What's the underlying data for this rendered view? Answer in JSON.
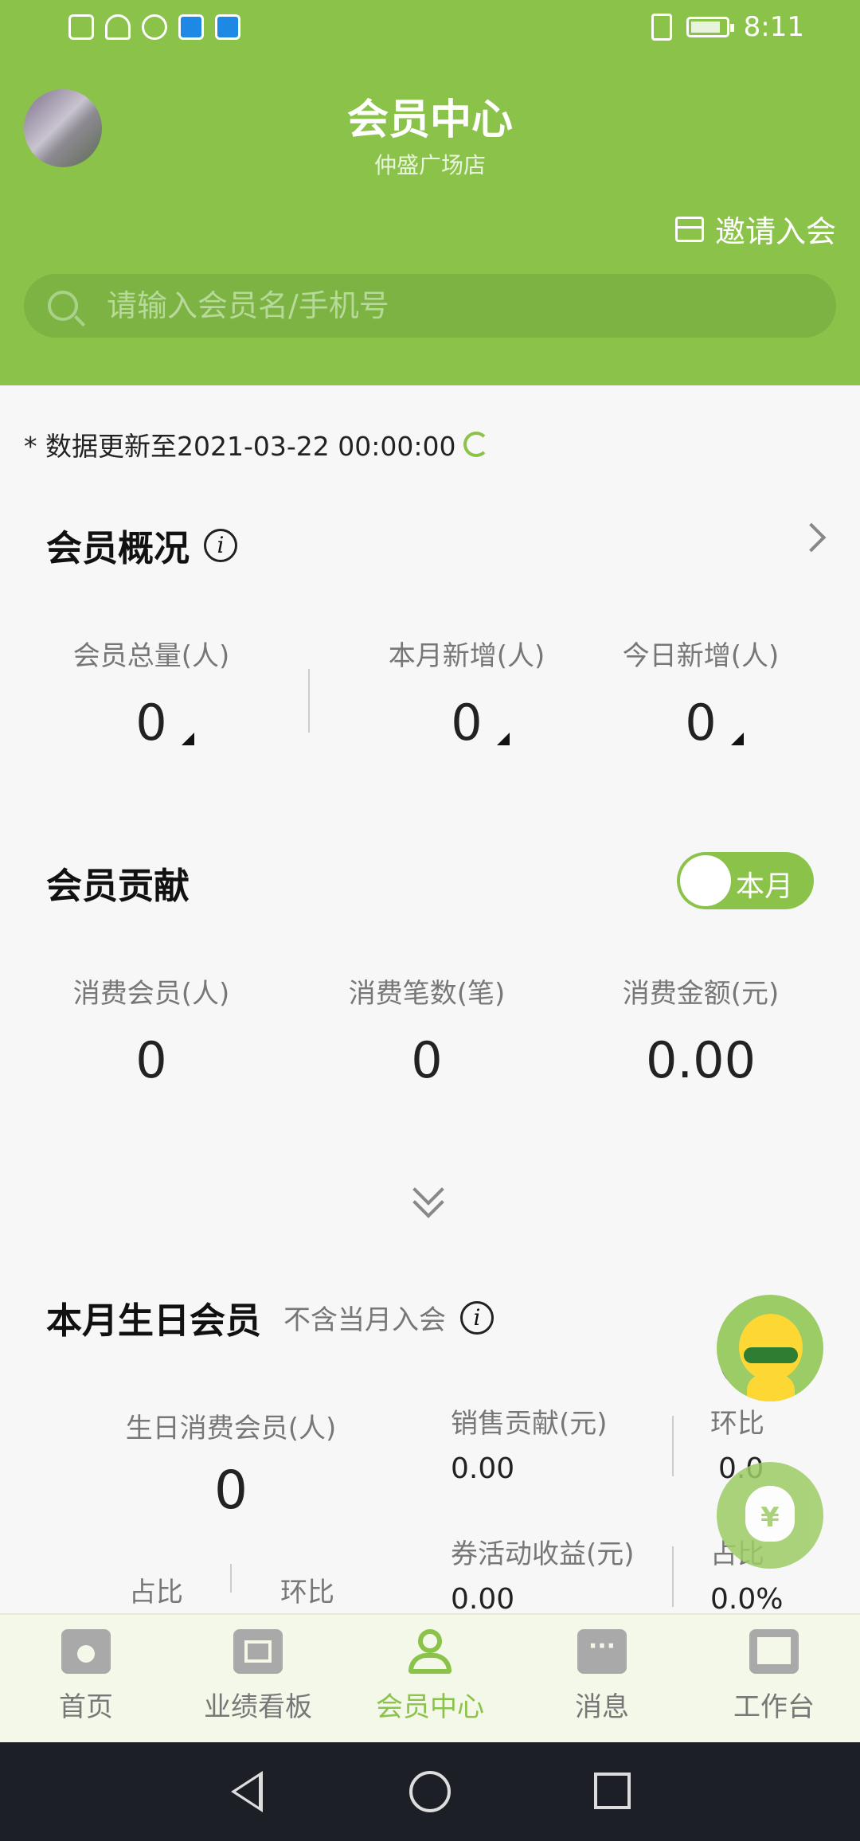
{
  "status_bar": {
    "time": "8:11"
  },
  "header": {
    "title": "会员中心",
    "subtitle": "仲盛广场店",
    "invite_label": "邀请入会",
    "search_placeholder": "请输入会员名/手机号"
  },
  "updated_text": "* 数据更新至2021-03-22 00:00:00",
  "overview": {
    "title": "会员概况",
    "stats": [
      {
        "label": "会员总量(人)",
        "value": "0"
      },
      {
        "label": "本月新增(人)",
        "value": "0"
      },
      {
        "label": "今日新增(人)",
        "value": "0"
      }
    ]
  },
  "contribution": {
    "title": "会员贡献",
    "toggle_label": "本月",
    "stats": [
      {
        "label": "消费会员(人)",
        "value": "0"
      },
      {
        "label": "消费笔数(笔)",
        "value": "0"
      },
      {
        "label": "消费金额(元)",
        "value": "0.00"
      }
    ]
  },
  "birthday": {
    "title": "本月生日会员",
    "note": "不含当月入会",
    "main_label": "生日消费会员(人)",
    "main_value": "0",
    "ratio_label": "占比",
    "mom_label": "环比",
    "sales_label": "销售贡献(元)",
    "sales_value": "0.00",
    "sales_mom_label": "环比",
    "sales_mom_value": "0.0",
    "coupon_label": "券活动收益(元)",
    "coupon_value": "0.00",
    "coupon_ratio_label": "占比",
    "coupon_ratio_value": "0.0%"
  },
  "tabs": [
    {
      "label": "首页",
      "icon": "home-icon"
    },
    {
      "label": "业绩看板",
      "icon": "dashboard-icon"
    },
    {
      "label": "会员中心",
      "icon": "member-icon",
      "active": true
    },
    {
      "label": "消息",
      "icon": "message-icon"
    },
    {
      "label": "工作台",
      "icon": "workbench-icon"
    }
  ],
  "colors": {
    "brand": "#8bc34a",
    "navbar": "#1c1f26"
  }
}
